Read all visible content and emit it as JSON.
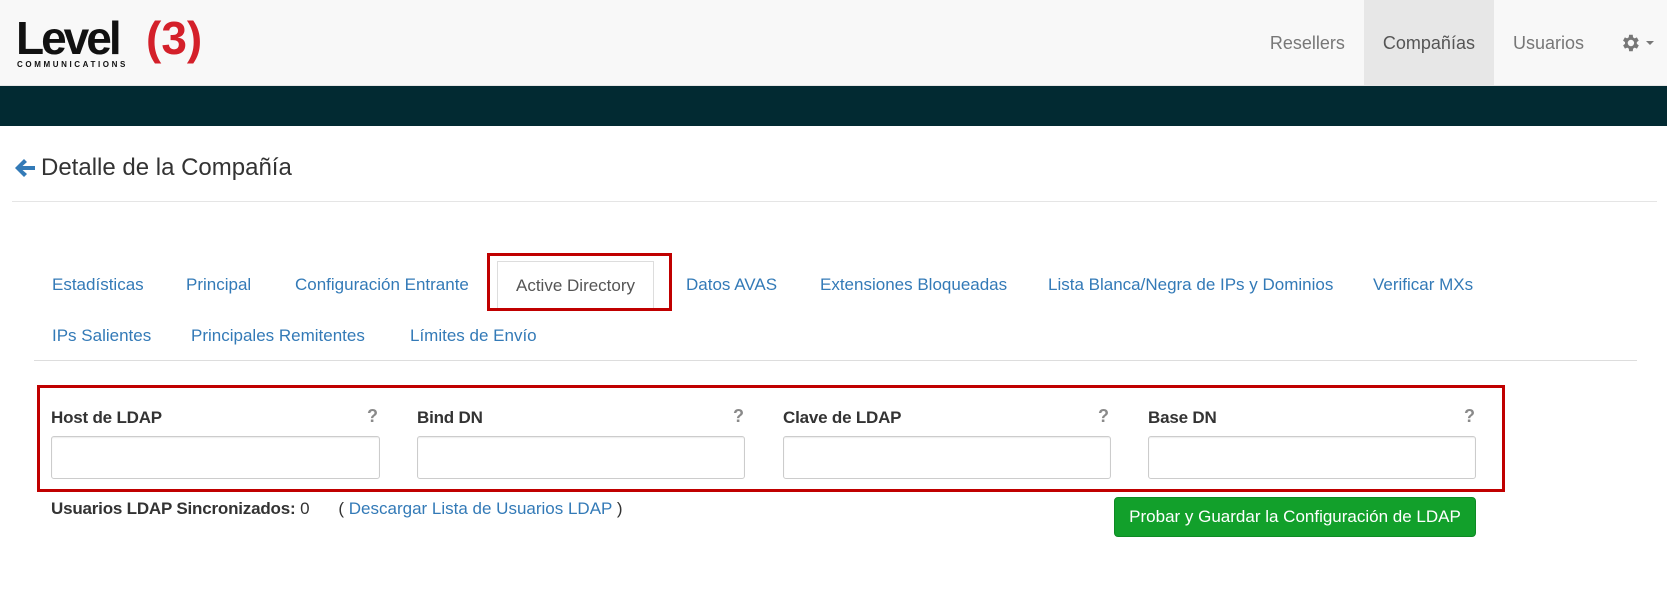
{
  "brand": {
    "logo_text": "Level",
    "logo_number": "(3)",
    "logo_subtext": "COMMUNICATIONS"
  },
  "nav": {
    "items": [
      {
        "label": "Resellers",
        "active": false
      },
      {
        "label": "Compañías",
        "active": true
      },
      {
        "label": "Usuarios",
        "active": false
      }
    ],
    "settings_icon": "gear-icon"
  },
  "page": {
    "title": "Detalle de la Compañía",
    "back_icon": "arrow-left-icon"
  },
  "tabs": [
    {
      "label": "Estadísticas",
      "active": false
    },
    {
      "label": "Principal",
      "active": false
    },
    {
      "label": "Configuración Entrante",
      "active": false
    },
    {
      "label": "Active Directory",
      "active": true
    },
    {
      "label": "Datos AVAS",
      "active": false
    },
    {
      "label": "Extensiones Bloqueadas",
      "active": false
    },
    {
      "label": "Lista Blanca/Negra de IPs y Dominios",
      "active": false
    },
    {
      "label": "Verificar MXs",
      "active": false
    },
    {
      "label": "IPs Salientes",
      "active": false
    },
    {
      "label": "Principales Remitentes",
      "active": false
    },
    {
      "label": "Límites de Envío",
      "active": false
    }
  ],
  "form": {
    "fields": [
      {
        "label": "Host de LDAP",
        "value": "",
        "help": "?"
      },
      {
        "label": "Bind DN",
        "value": "",
        "help": "?"
      },
      {
        "label": "Clave de LDAP",
        "value": "",
        "help": "?"
      },
      {
        "label": "Base DN",
        "value": "",
        "help": "?"
      }
    ],
    "sync_label": "Usuarios LDAP Sincronizados:",
    "sync_count": "0",
    "paren_open": "(",
    "download_link": "Descargar Lista de Usuarios LDAP",
    "paren_close": ")",
    "save_button": "Probar y Guardar la Configuración de LDAP"
  },
  "colors": {
    "band": "#022a32",
    "link": "#337ab7",
    "highlight": "#c00000",
    "button": "#12a02b",
    "logo_red": "#d4202a"
  }
}
